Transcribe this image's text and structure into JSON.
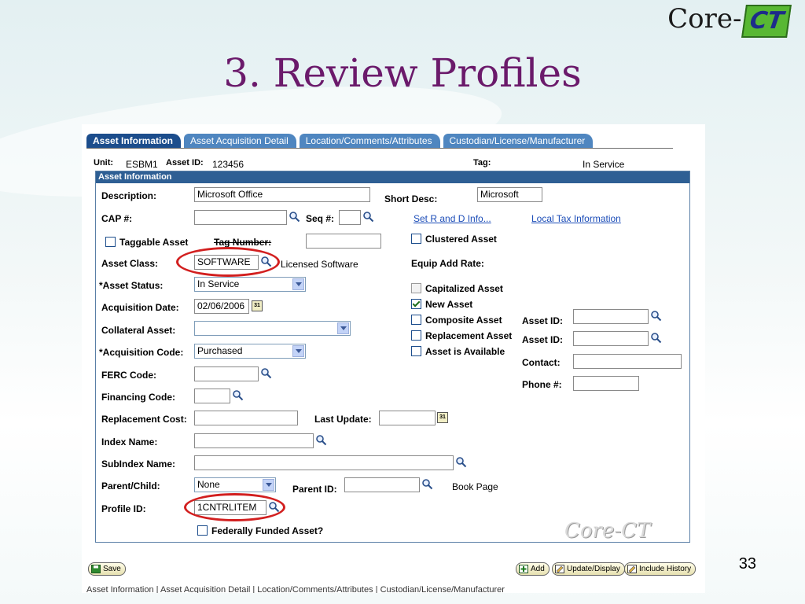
{
  "slide": {
    "title": "3. Review Profiles",
    "page_number": "33",
    "logo_core": "Core-",
    "logo_ct": "CT"
  },
  "tabs": [
    {
      "label": "Asset Information",
      "active": true
    },
    {
      "label": "Asset Acquisition Detail",
      "active": false
    },
    {
      "label": "Location/Comments/Attributes",
      "active": false
    },
    {
      "label": "Custodian/License/Manufacturer",
      "active": false
    }
  ],
  "header": {
    "unit_label": "Unit:",
    "unit_value": "ESBM1",
    "asset_id_label": "Asset ID:",
    "asset_id_value": "123456",
    "tag_label": "Tag:",
    "tag_value": "In Service"
  },
  "panel": {
    "title": "Asset Information",
    "description_label": "Description:",
    "description_value": "Microsoft Office",
    "short_desc_label": "Short Desc:",
    "short_desc_value": "Microsoft",
    "cap_label": "CAP #:",
    "cap_value": "",
    "seq_label": "Seq #:",
    "seq_value": "",
    "set_rd_link": "Set R and D Info...",
    "local_tax_link": "Local Tax Information",
    "taggable_label": "Taggable Asset",
    "tag_number_label": "Tag Number:",
    "tag_number_value": "",
    "clustered_label": "Clustered Asset",
    "asset_class_label": "Asset Class:",
    "asset_class_value": "SOFTWARE",
    "asset_class_desc": "Licensed Software",
    "equip_add_rate_label": "Equip Add Rate:",
    "asset_status_label": "*Asset Status:",
    "asset_status_value": "In Service",
    "capitalized_label": "Capitalized Asset",
    "new_asset_label": "New Asset",
    "acq_date_label": "Acquisition Date:",
    "acq_date_value": "02/06/2006",
    "composite_label": "Composite Asset",
    "replacement_asset_label": "Replacement Asset",
    "asset_available_label": "Asset is Available",
    "asset_id1_label": "Asset ID:",
    "asset_id2_label": "Asset ID:",
    "contact_label": "Contact:",
    "phone_label": "Phone #:",
    "collateral_label": "Collateral Asset:",
    "collateral_value": "",
    "acq_code_label": "*Acquisition Code:",
    "acq_code_value": "Purchased",
    "ferc_label": "FERC Code:",
    "financing_label": "Financing Code:",
    "replacement_cost_label": "Replacement Cost:",
    "last_update_label": "Last Update:",
    "index_name_label": "Index Name:",
    "subindex_label": "SubIndex Name:",
    "parent_child_label": "Parent/Child:",
    "parent_child_value": "None",
    "parent_id_label": "Parent ID:",
    "book_page_label": "Book Page",
    "profile_id_label": "Profile ID:",
    "profile_id_value": "1CNTRLITEM",
    "federally_funded_label": "Federally Funded Asset?",
    "watermark": "Core-CT"
  },
  "buttons": {
    "save": "Save",
    "add": "Add",
    "update_display": "Update/Display",
    "include_history": "Include History"
  },
  "footer_links": "Asset Information | Asset Acquisition Detail | Location/Comments/Attributes | Custodian/License/Manufacturer",
  "colors": {
    "title": "#6b1a6b",
    "tab_active": "#1c4d8c",
    "tab": "#4f86c0",
    "highlight_ring": "#d21f1f"
  }
}
